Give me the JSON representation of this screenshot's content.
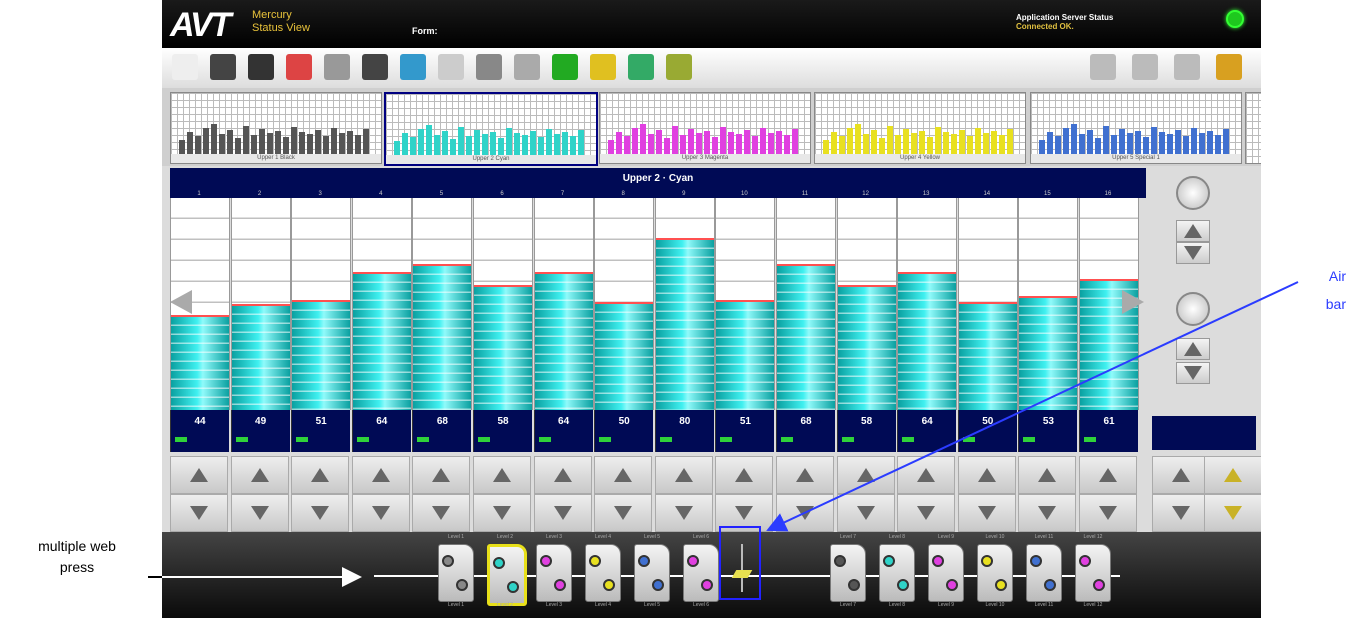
{
  "window": {
    "logo": "AVT",
    "app_line1": "Mercury",
    "app_line2": "Status View",
    "form_label": "Form:",
    "server_status_title": "Application Server Status",
    "server_status_value": "Connected OK."
  },
  "toolbar": {
    "left_icons": [
      "new-document-icon",
      "edit-pen-icon",
      "save-disk-icon",
      "print-target-icon",
      "settings-doc-icon",
      "percent-dial-icon",
      "copy-icon",
      "flask-icon",
      "curve-icon",
      "percent-icon",
      "green-check-icon",
      "lock-icon",
      "stacked-bars-icon",
      "chart-hand-icon"
    ],
    "right_icons": [
      "adjust-sliders-icon",
      "roller-icon",
      "separator-icon",
      "padlock-icon"
    ]
  },
  "thumbnails": [
    {
      "label": "Upper 1 Black",
      "color": "#555555",
      "selected": false
    },
    {
      "label": "Upper 2 Cyan",
      "color": "#2fd3c8",
      "selected": true
    },
    {
      "label": "Upper 3 Magenta",
      "color": "#e040e0",
      "selected": false
    },
    {
      "label": "Upper 4 Yellow",
      "color": "#e8e020",
      "selected": false
    },
    {
      "label": "Upper 5 Special 1",
      "color": "#4070d0",
      "selected": false
    }
  ],
  "ink_panel": {
    "title": "Upper 2 · Cyan",
    "zone_numbers": [
      "1",
      "2",
      "3",
      "4",
      "5",
      "6",
      "7",
      "8",
      "9",
      "10",
      "11",
      "12",
      "13",
      "14",
      "15",
      "16"
    ],
    "zone_values": [
      "44",
      "49",
      "51",
      "64",
      "68",
      "58",
      "64",
      "50",
      "80",
      "51",
      "68",
      "58",
      "64",
      "50",
      "53",
      "61"
    ],
    "zone_levels": [
      44,
      49,
      51,
      64,
      68,
      58,
      64,
      50,
      80,
      51,
      68,
      58,
      64,
      50,
      53,
      61
    ],
    "level_max": 100
  },
  "press": {
    "units_left": [
      {
        "head": "Level 1",
        "label": "Level 1",
        "colors": [
          "#888888",
          "#888888"
        ],
        "selected": false
      },
      {
        "head": "Level 2",
        "label": "Level 2",
        "colors": [
          "#2fd3c8",
          "#2fd3c8"
        ],
        "selected": true
      },
      {
        "head": "Level 3",
        "label": "Level 3",
        "colors": [
          "#e040e0",
          "#e040e0"
        ],
        "selected": false
      },
      {
        "head": "Level 4",
        "label": "Level 4",
        "colors": [
          "#e8e020",
          "#e8e020"
        ],
        "selected": false
      },
      {
        "head": "Level 5",
        "label": "Level 5",
        "colors": [
          "#4070d0",
          "#4070d0"
        ],
        "selected": false
      },
      {
        "head": "Level 6",
        "label": "Level 6",
        "colors": [
          "#e040e0",
          "#e040e0"
        ],
        "selected": false
      }
    ],
    "units_right": [
      {
        "head": "Level 7",
        "label": "Level 7",
        "colors": [
          "#555555",
          "#555555"
        ],
        "selected": false
      },
      {
        "head": "Level 8",
        "label": "Level 8",
        "colors": [
          "#2fd3c8",
          "#2fd3c8"
        ],
        "selected": false
      },
      {
        "head": "Level 9",
        "label": "Level 9",
        "colors": [
          "#e040e0",
          "#e040e0"
        ],
        "selected": false
      },
      {
        "head": "Level 10",
        "label": "Level 10",
        "colors": [
          "#e8e020",
          "#e8e020"
        ],
        "selected": false
      },
      {
        "head": "Level 11",
        "label": "Level 11",
        "colors": [
          "#4070d0",
          "#4070d0"
        ],
        "selected": false
      },
      {
        "head": "Level 12",
        "label": "Level 12",
        "colors": [
          "#e040e0",
          "#e040e0"
        ],
        "selected": false
      }
    ]
  },
  "annotations": {
    "air_bar_line1": "Air",
    "air_bar_line2": "bar",
    "web_line1": "multiple web",
    "web_line2": "press"
  },
  "colors": {
    "ink_fill": "#2fd3c8",
    "panel_navy": "#000a55",
    "annotation_blue": "#2b3cff"
  }
}
